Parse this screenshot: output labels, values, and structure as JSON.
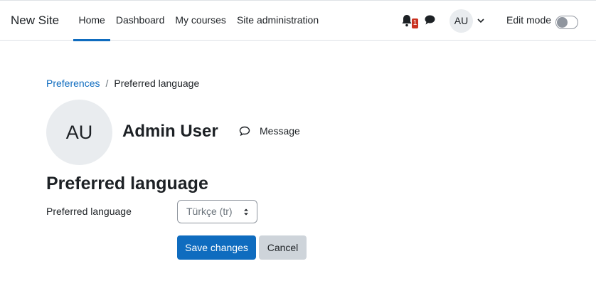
{
  "navbar": {
    "site_name": "New Site",
    "links": [
      {
        "label": "Home",
        "active": true
      },
      {
        "label": "Dashboard",
        "active": false
      },
      {
        "label": "My courses",
        "active": false
      },
      {
        "label": "Site administration",
        "active": false
      }
    ],
    "notification_count": "1",
    "user_initials": "AU",
    "edit_mode_label": "Edit mode",
    "edit_mode_on": false
  },
  "breadcrumb": {
    "parent": "Preferences",
    "separator": "/",
    "current": "Preferred language"
  },
  "profile": {
    "initials": "AU",
    "name": "Admin User",
    "message_label": "Message"
  },
  "page": {
    "heading": "Preferred language",
    "field_label": "Preferred language",
    "selected_language": "Türkçe (tr)",
    "save_label": "Save changes",
    "cancel_label": "Cancel"
  },
  "colors": {
    "brand": "#0f6cbf",
    "badge": "#ca3120",
    "secondary_button": "#ced4da"
  },
  "icons": [
    "bell-icon",
    "chat-icon",
    "chevron-down-icon",
    "message-icon",
    "select-arrows-icon"
  ]
}
